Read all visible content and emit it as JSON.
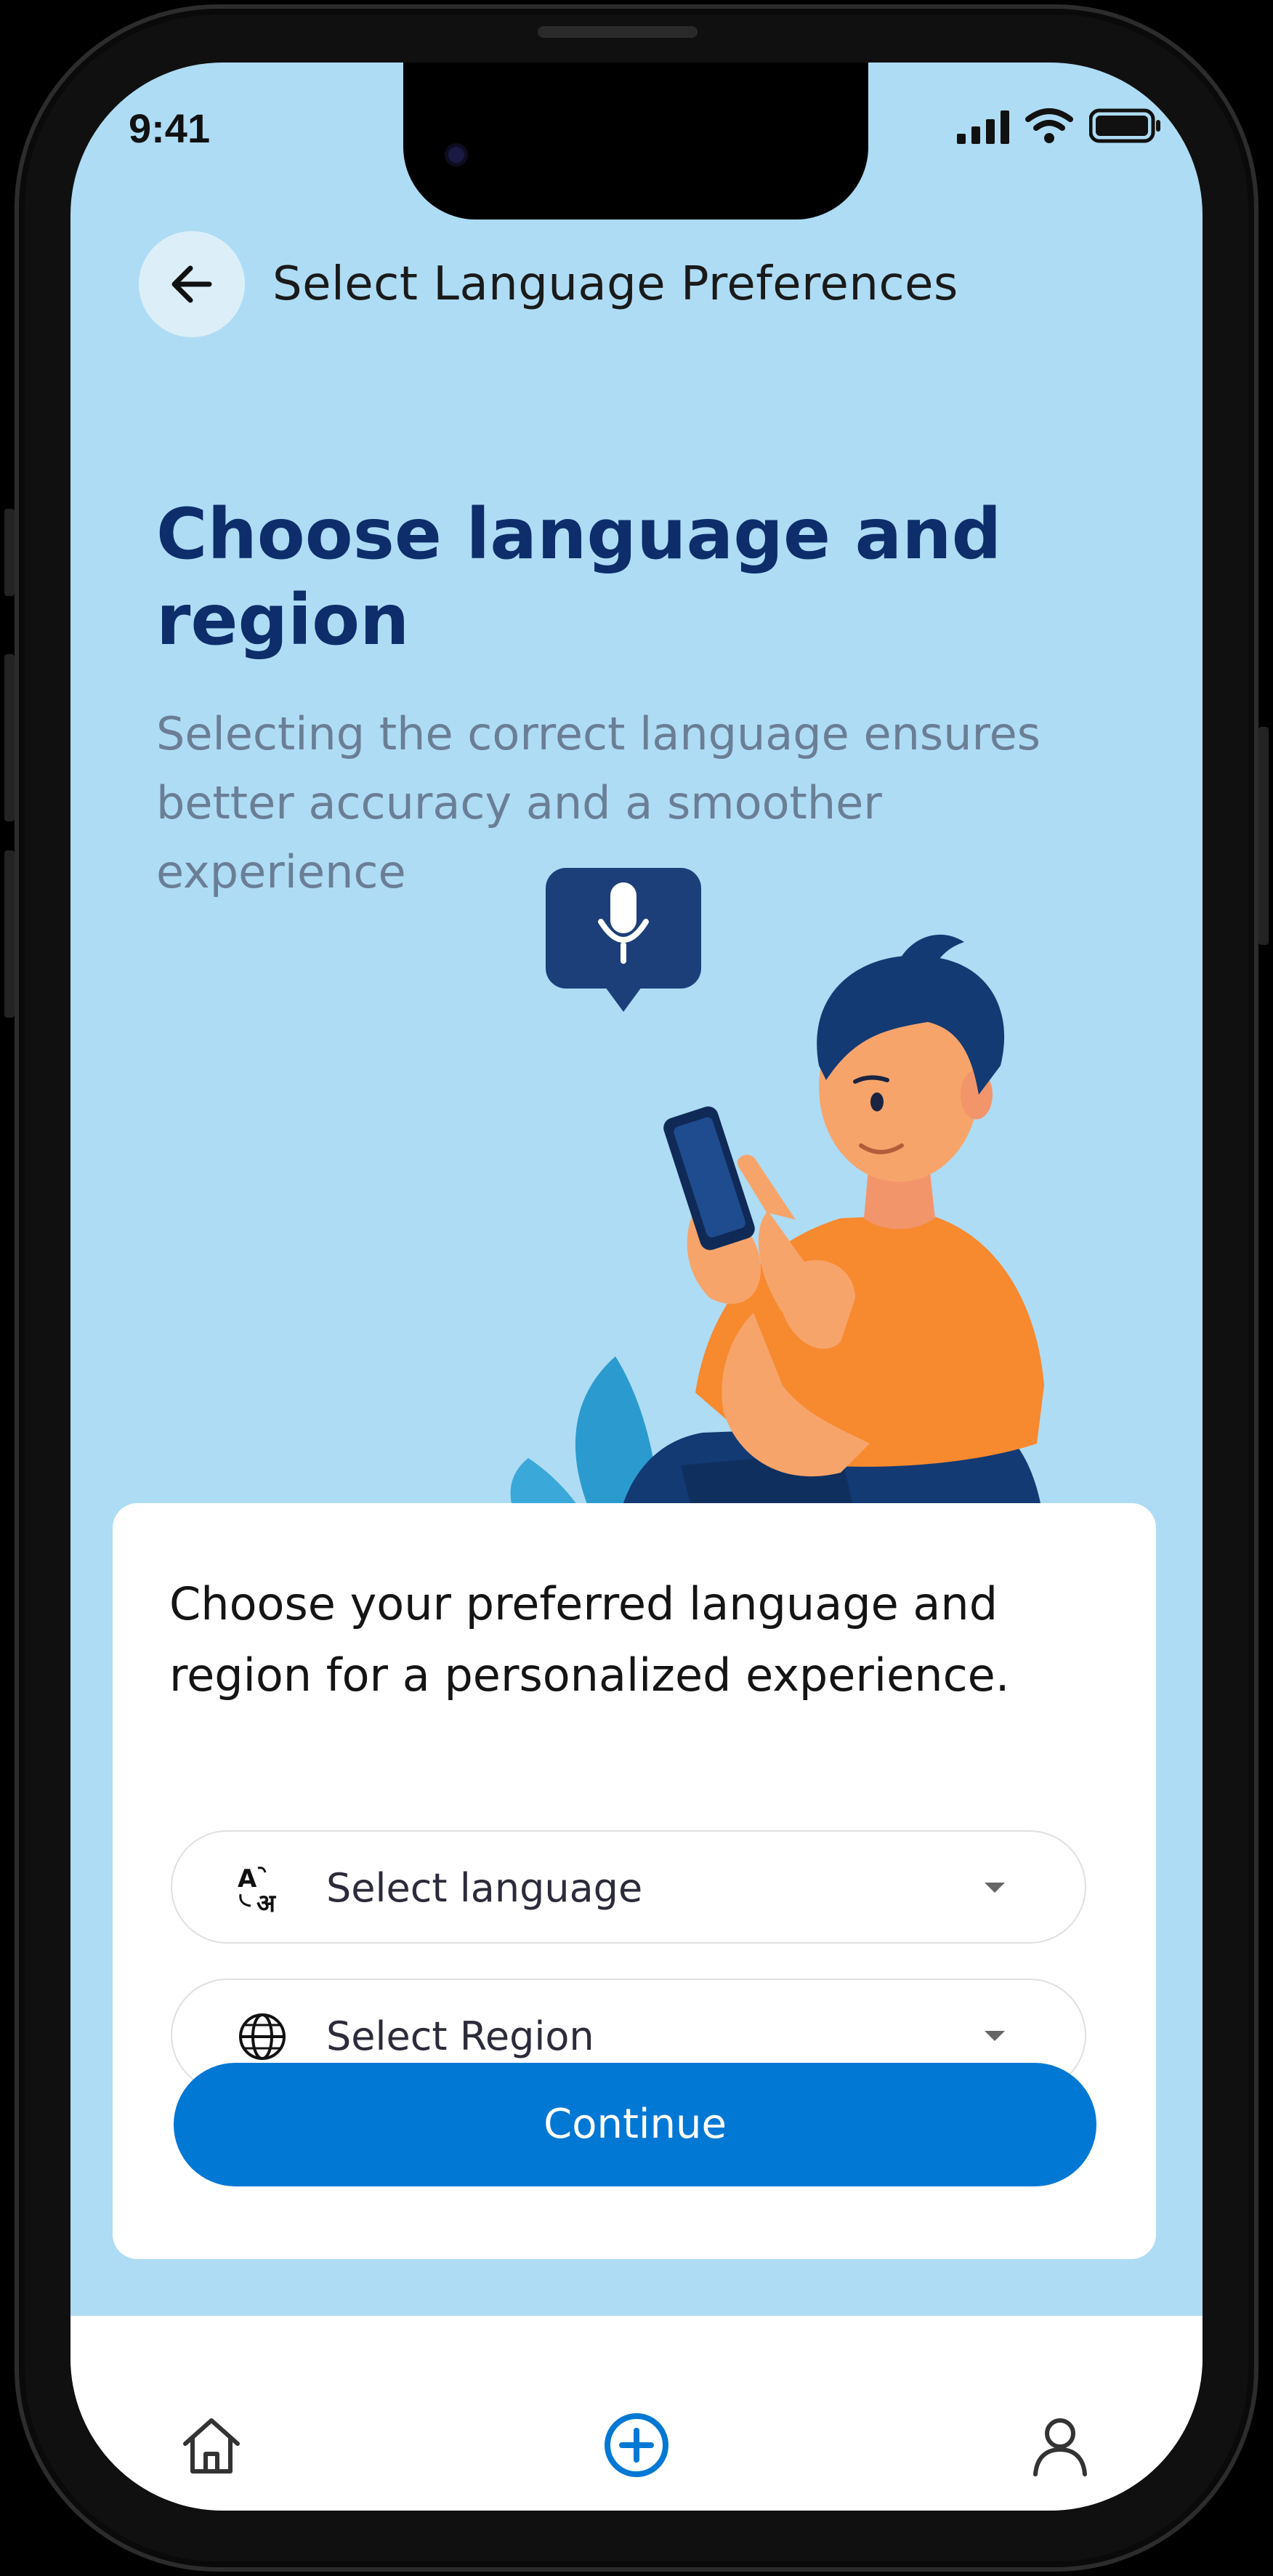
{
  "status_bar": {
    "time": "9:41"
  },
  "header": {
    "back_icon": "arrow-left-icon",
    "title": "Select Language Preferences"
  },
  "hero": {
    "headline": "Choose language and region",
    "subtitle": "Selecting the correct language ensures better accuracy and a smoother experience"
  },
  "illustration": {
    "icon": "microphone-icon"
  },
  "card": {
    "prompt": "Choose your preferred language and region for a personalized experience.",
    "language_select": {
      "icon": "translate-icon",
      "label": "Select language"
    },
    "region_select": {
      "icon": "globe-icon",
      "label": "Select Region"
    },
    "continue_label": "Continue"
  },
  "tab_bar": {
    "items": [
      "home-icon",
      "add-circle-icon",
      "user-icon"
    ]
  },
  "colors": {
    "background": "#aedcf4",
    "headline": "#0d2d6b",
    "accent": "#0078d4",
    "shirt": "#f7892f",
    "pants": "#123a74"
  }
}
